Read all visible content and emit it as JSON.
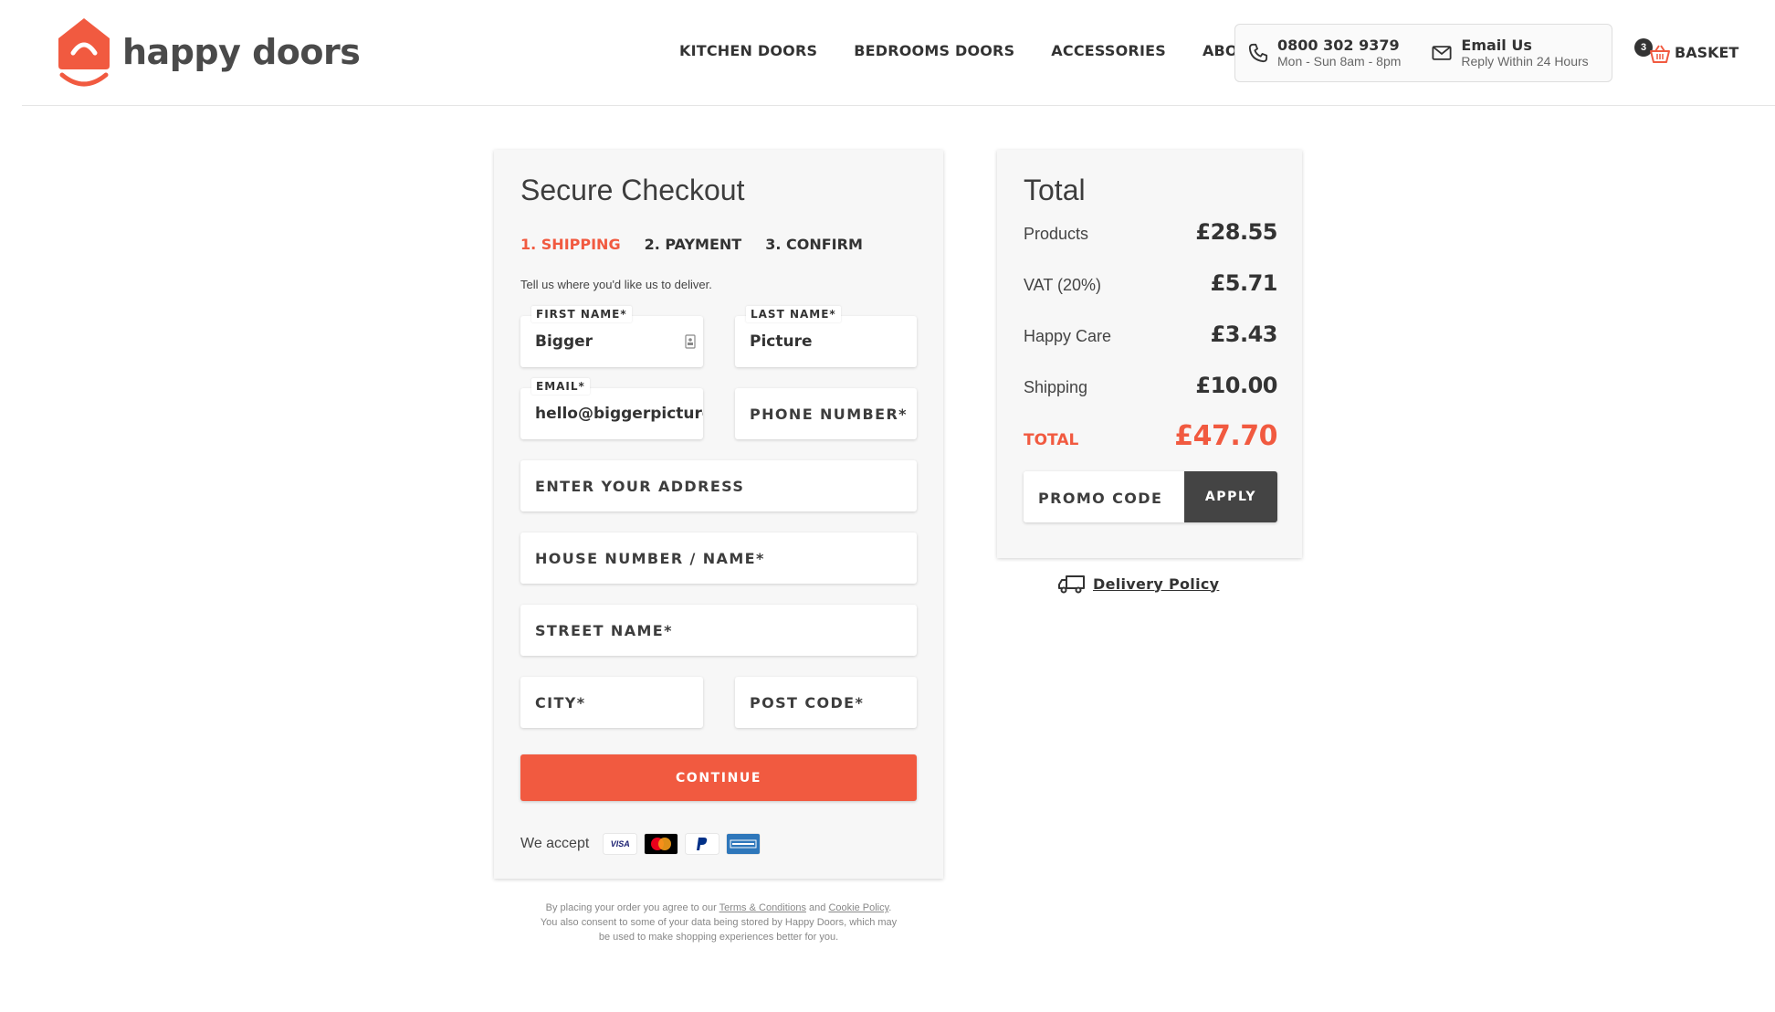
{
  "brand": {
    "name": "happy doors",
    "color": "#f15a40"
  },
  "nav": {
    "items": [
      {
        "label": "KITCHEN DOORS"
      },
      {
        "label": "BEDROOMS DOORS"
      },
      {
        "label": "ACCESSORIES"
      },
      {
        "label": "ABOUT"
      }
    ]
  },
  "contact": {
    "phone": {
      "number": "0800 302 9379",
      "hours": "Mon - Sun 8am - 8pm",
      "icon": "phone-icon"
    },
    "email": {
      "label": "Email Us",
      "sub": "Reply Within 24 Hours",
      "icon": "mail-icon"
    }
  },
  "basket": {
    "count": "3",
    "label": "BASKET",
    "icon": "basket-icon"
  },
  "checkout": {
    "title": "Secure Checkout",
    "steps": [
      {
        "label": "1. SHIPPING",
        "active": true
      },
      {
        "label": "2. PAYMENT",
        "active": false
      },
      {
        "label": "3. CONFIRM",
        "active": false
      }
    ],
    "hint": "Tell us where you'd like us to deliver.",
    "fields": {
      "first_name": {
        "label": "FIRST NAME*",
        "value": "Bigger"
      },
      "last_name": {
        "label": "LAST NAME*",
        "value": "Picture"
      },
      "email": {
        "label": "EMAIL*",
        "value": "hello@biggerpicture"
      },
      "phone": {
        "placeholder": "PHONE NUMBER*"
      },
      "address": {
        "placeholder": "ENTER YOUR ADDRESS"
      },
      "house": {
        "placeholder": "HOUSE NUMBER / NAME*"
      },
      "street": {
        "placeholder": "STREET NAME*"
      },
      "city": {
        "placeholder": "CITY*"
      },
      "postcode": {
        "placeholder": "POST CODE*"
      }
    },
    "continue_label": "CONTINUE",
    "accept_label": "We accept",
    "payment_methods": [
      "VISA",
      "Mastercard",
      "PayPal",
      "AMEX"
    ]
  },
  "legal": {
    "pre": "By placing your order you agree to our ",
    "terms": "Terms & Conditions",
    "and": " and ",
    "cookie": "Cookie Policy",
    "post": ". You also consent to some of your data being stored by Happy Doors, which may be used to make shopping experiences better for you."
  },
  "totals": {
    "title": "Total",
    "rows": [
      {
        "label": "Products",
        "value": "£28.55"
      },
      {
        "label": "VAT (20%)",
        "value": "£5.71"
      },
      {
        "label": "Happy Care",
        "value": "£3.43"
      },
      {
        "label": "Shipping",
        "value": "£10.00"
      }
    ],
    "total": {
      "label": "TOTAL",
      "value": "£47.70"
    },
    "promo_placeholder": "PROMO CODE",
    "apply_label": "APPLY"
  },
  "delivery": {
    "label": "Delivery Policy",
    "icon": "truck-icon"
  }
}
